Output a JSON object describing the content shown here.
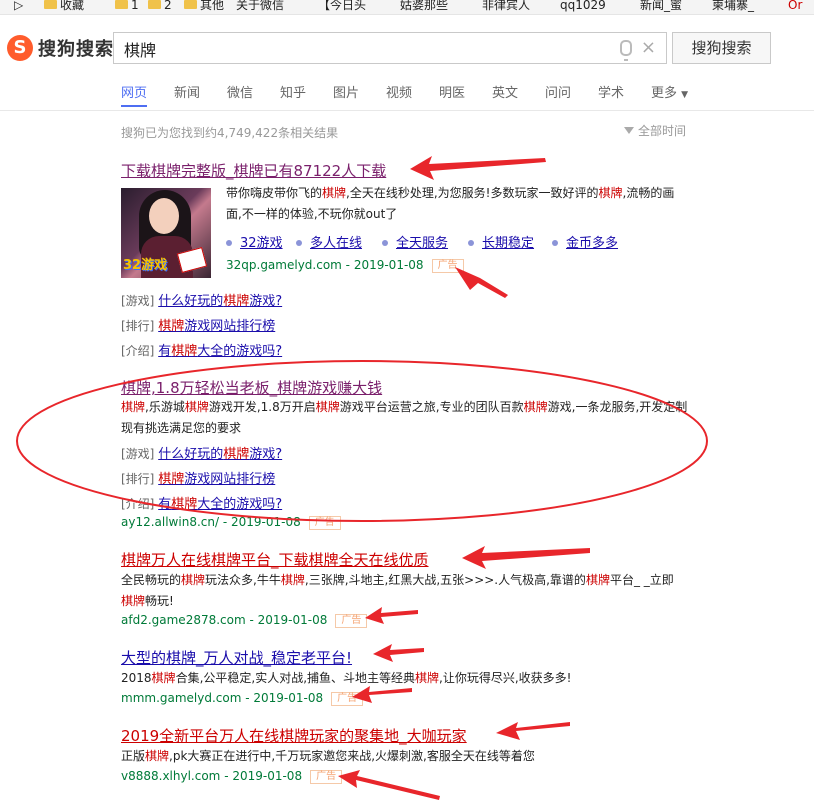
{
  "bookmarks": {
    "items": [
      "▷",
      "收藏",
      "1",
      "2",
      "其他",
      "关于微信",
      "【今日头",
      "姑婆那些",
      "非律宾人",
      "qq1029",
      "新闻_蜜",
      "柬埔寨_",
      "Or"
    ]
  },
  "header": {
    "logo_text": "搜狗搜索",
    "search_value": "棋牌",
    "clear_symbol": "×",
    "search_button": "搜狗搜索"
  },
  "tabs": [
    "网页",
    "新闻",
    "微信",
    "知乎",
    "图片",
    "视频",
    "明医",
    "英文",
    "问问",
    "学术",
    "更多"
  ],
  "results_meta": {
    "count": "搜狗已为您找到约4,749,422条相关结果",
    "filter": "全部时间"
  },
  "results": [
    {
      "title": "下载棋牌完整版_棋牌已有87122人下载",
      "desc": "带你嗨皮带你飞的棋牌,全天在线秒处理,为您服务!多数玩家一致好评的棋牌,流畅的画面,不一样的体验,不玩你就out了",
      "thumb_label": "32游戏",
      "tags": [
        "32游戏",
        "多人在线",
        "全天服务",
        "长期稳定",
        "金币多多"
      ],
      "url": "32qp.gamelyd.com - 2019-01-08",
      "ad": "广告",
      "sublinks": [
        {
          "prefix": "[游戏]",
          "text": "什么好玩的棋牌游戏?"
        },
        {
          "prefix": "[排行]",
          "text": "棋牌游戏网站排行榜"
        },
        {
          "prefix": "[介绍]",
          "text": "有棋牌大全的游戏吗?"
        }
      ]
    },
    {
      "title": "棋牌,1.8万轻松当老板_棋牌游戏赚大钱",
      "desc": "棋牌,乐游城棋牌游戏开发,1.8万开启棋牌游戏平台运营之旅,专业的团队百款棋牌游戏,一条龙服务,开发定制现有挑选满足您的要求",
      "url": "ay12.allwin8.cn/ - 2019-01-08",
      "ad": "广告",
      "sublinks": [
        {
          "prefix": "[游戏]",
          "text": "什么好玩的棋牌游戏?"
        },
        {
          "prefix": "[排行]",
          "text": "棋牌游戏网站排行榜"
        },
        {
          "prefix": "[介绍]",
          "text": "有棋牌大全的游戏吗?"
        }
      ]
    },
    {
      "title": "棋牌万人在线棋牌平台_下载棋牌全天在线优质",
      "desc": "全民畅玩的棋牌玩法众多,牛牛棋牌,三张牌,斗地主,红黑大战,五张>>>.人气极高,靠谱的棋牌平台_ _立即棋牌畅玩!",
      "url": "afd2.game2878.com - 2019-01-08",
      "ad": "广告"
    },
    {
      "title": "大型的棋牌_万人对战_稳定老平台!",
      "desc": "2018棋牌合集,公平稳定,实人对战,捕鱼、斗地主等经典棋牌,让你玩得尽兴,收获多多!",
      "url": "mmm.gamelyd.com - 2019-01-08",
      "ad": "广告"
    },
    {
      "title": "2019全新平台万人在线棋牌玩家的聚集地_大咖玩家",
      "desc": "正版棋牌,pk大赛正在进行中,千万玩家邀您来战,火爆刺激,客服全天在线等着您",
      "url": "v8888.xlhyl.com - 2019-01-08",
      "ad": "广告"
    }
  ],
  "colors": {
    "annotation": "#e8262b",
    "link": "#1a0dab",
    "url": "#007a38",
    "keyword": "#cc0000",
    "accent": "#4e6ef2"
  }
}
